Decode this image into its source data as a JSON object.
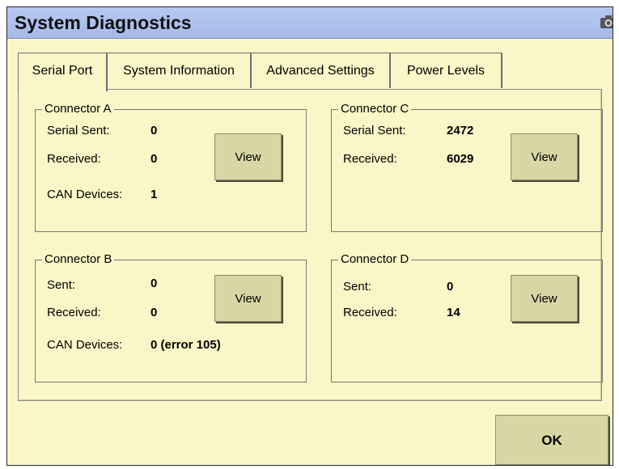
{
  "window": {
    "title": "System Diagnostics",
    "icon": "camera-icon",
    "title_bar_color": "#a8bbeb",
    "background_color": "#f9f6c8"
  },
  "tabs": [
    {
      "label": "Serial Port",
      "active": true
    },
    {
      "label": "System Information",
      "active": false
    },
    {
      "label": "Advanced Settings",
      "active": false
    },
    {
      "label": "Power Levels",
      "active": false
    }
  ],
  "connectors": {
    "a": {
      "title": "Connector A",
      "rows": [
        {
          "label": "Serial Sent:",
          "value": "0"
        },
        {
          "label": "Received:",
          "value": "0"
        },
        {
          "label": "CAN Devices:",
          "value": "1"
        }
      ],
      "button": "View"
    },
    "b": {
      "title": "Connector B",
      "rows": [
        {
          "label": "Sent:",
          "value": "0"
        },
        {
          "label": "Received:",
          "value": "0"
        },
        {
          "label": "CAN Devices:",
          "value": "0 (error 105)"
        }
      ],
      "button": "View"
    },
    "c": {
      "title": "Connector C",
      "rows": [
        {
          "label": "Serial Sent:",
          "value": "2472"
        },
        {
          "label": "Received:",
          "value": "6029"
        }
      ],
      "button": "View"
    },
    "d": {
      "title": "Connector D",
      "rows": [
        {
          "label": "Sent:",
          "value": "0"
        },
        {
          "label": "Received:",
          "value": "14"
        }
      ],
      "button": "View"
    }
  },
  "footer": {
    "ok_label": "OK"
  }
}
